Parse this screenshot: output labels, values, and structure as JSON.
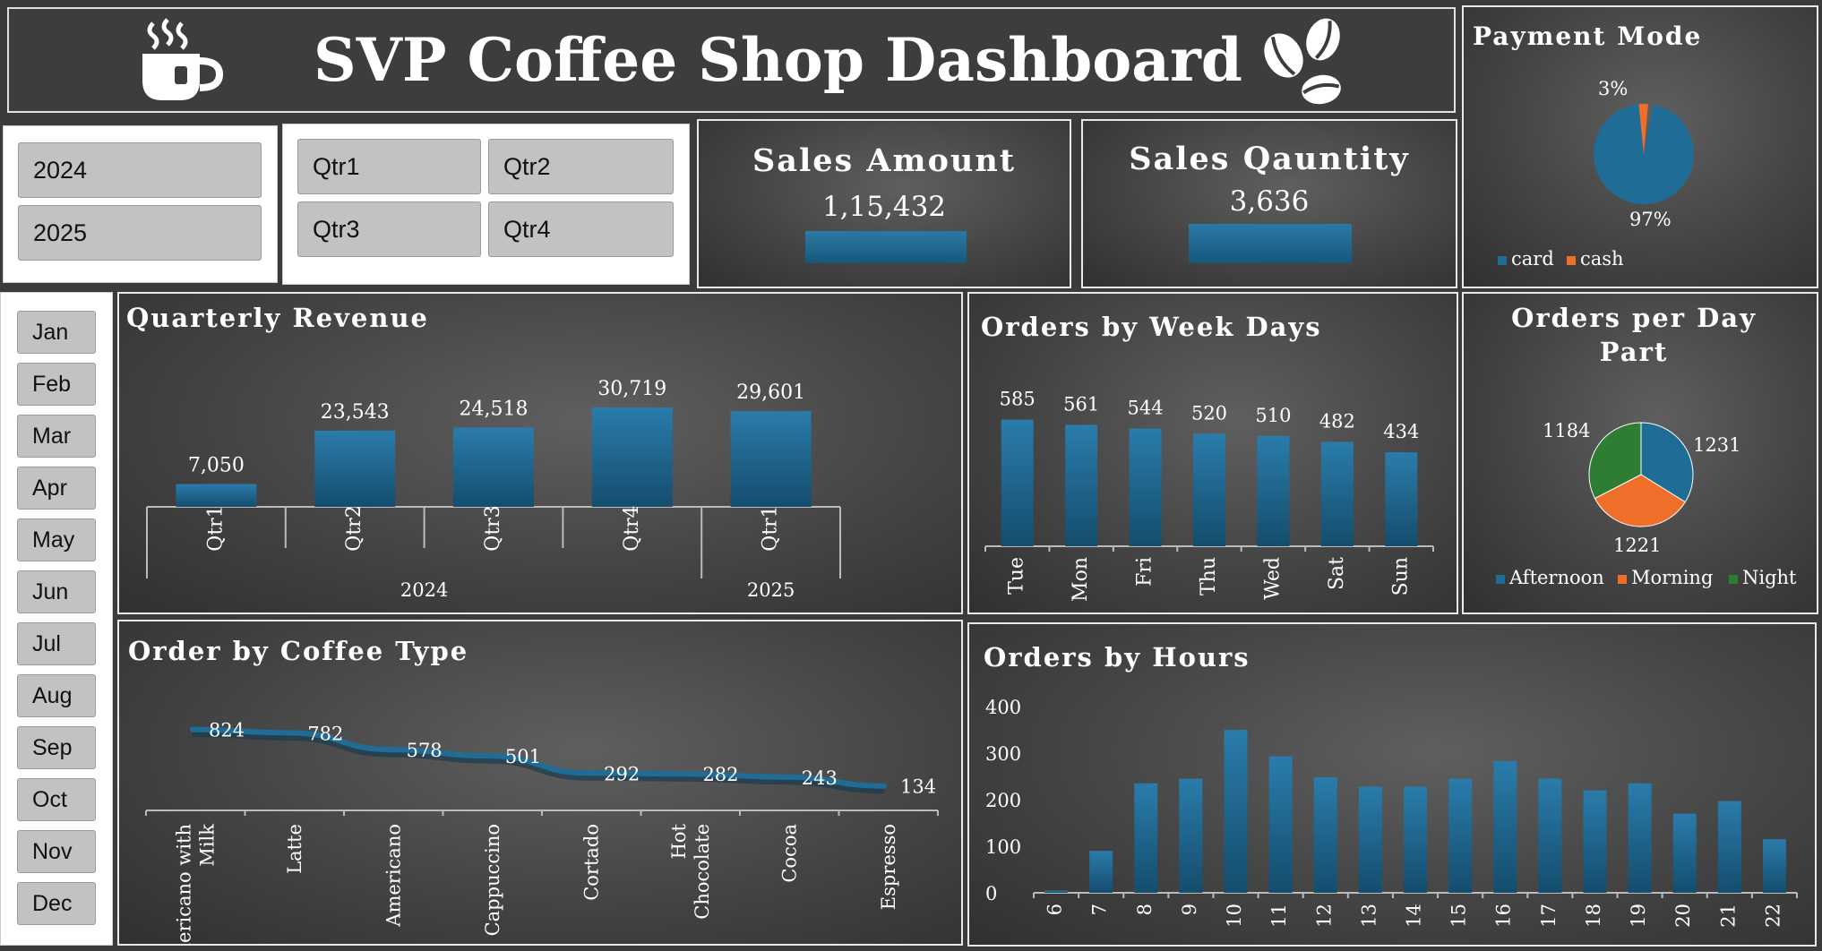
{
  "header": {
    "title": "SVP Coffee Shop Dashboard"
  },
  "colors": {
    "bar": "#1f6d97",
    "card": "#1f6d97",
    "cash": "#ee6e2a",
    "afternoon": "#1f6d97",
    "morning": "#ee6e2a",
    "night": "#2e7d32"
  },
  "icons": {
    "left": "coffee-cup-icon",
    "right": "coffee-beans-icon"
  },
  "slicers": {
    "years": [
      "2024",
      "2025"
    ],
    "quarters": [
      "Qtr1",
      "Qtr2",
      "Qtr3",
      "Qtr4"
    ],
    "months": [
      "Jan",
      "Feb",
      "Mar",
      "Apr",
      "May",
      "Jun",
      "Jul",
      "Aug",
      "Sep",
      "Oct",
      "Nov",
      "Dec"
    ]
  },
  "kpis": {
    "sales_amount": {
      "label": "Sales Amount",
      "value": "1,15,432"
    },
    "sales_quantity": {
      "label": "Sales Qauntity",
      "value": "3,636"
    }
  },
  "chart_data": [
    {
      "id": "payment-mode",
      "type": "pie",
      "title": "Payment Mode",
      "categories": [
        "card",
        "cash"
      ],
      "values": [
        97,
        3
      ],
      "labels": [
        "97%",
        "3%"
      ],
      "legend": "bottom"
    },
    {
      "id": "quarterly-revenue",
      "type": "bar",
      "title": "Quarterly Revenue",
      "categories": [
        "Qtr1",
        "Qtr2",
        "Qtr3",
        "Qtr4",
        "Qtr1"
      ],
      "groups": [
        {
          "label": "2024",
          "span": 4
        },
        {
          "label": "2025",
          "span": 1
        }
      ],
      "values": [
        7050,
        23543,
        24518,
        30719,
        29601
      ],
      "labels": [
        "7,050",
        "23,543",
        "24,518",
        "30,719",
        "29,601"
      ]
    },
    {
      "id": "orders-by-week-days",
      "type": "bar",
      "title": "Orders by Week Days",
      "categories": [
        "Tue",
        "Mon",
        "Fri",
        "Thu",
        "Wed",
        "Sat",
        "Sun"
      ],
      "values": [
        585,
        561,
        544,
        520,
        510,
        482,
        434
      ]
    },
    {
      "id": "orders-per-day-part",
      "type": "pie",
      "title": "Orders per Day Part",
      "categories": [
        "Afternoon",
        "Morning",
        "Night"
      ],
      "values": [
        1231,
        1221,
        1184
      ],
      "legend": "bottom"
    },
    {
      "id": "order-by-coffee-type",
      "type": "line",
      "title": "Order by Coffee Type",
      "categories": [
        "Americano with Milk",
        "Latte",
        "Americano",
        "Cappuccino",
        "Cortado",
        "Hot Chocolate",
        "Cocoa",
        "Espresso"
      ],
      "values": [
        824,
        782,
        578,
        501,
        292,
        282,
        243,
        134
      ]
    },
    {
      "id": "orders-by-hours",
      "type": "bar",
      "title": "Orders by Hours",
      "categories": [
        "6",
        "7",
        "8",
        "9",
        "10",
        "11",
        "12",
        "13",
        "14",
        "15",
        "16",
        "17",
        "18",
        "19",
        "20",
        "21",
        "22"
      ],
      "values": [
        5,
        90,
        235,
        245,
        350,
        293,
        248,
        228,
        228,
        245,
        283,
        245,
        220,
        235,
        170,
        197,
        115
      ],
      "ylim": [
        0,
        400
      ],
      "yticks": [
        0,
        100,
        200,
        300,
        400
      ]
    }
  ]
}
